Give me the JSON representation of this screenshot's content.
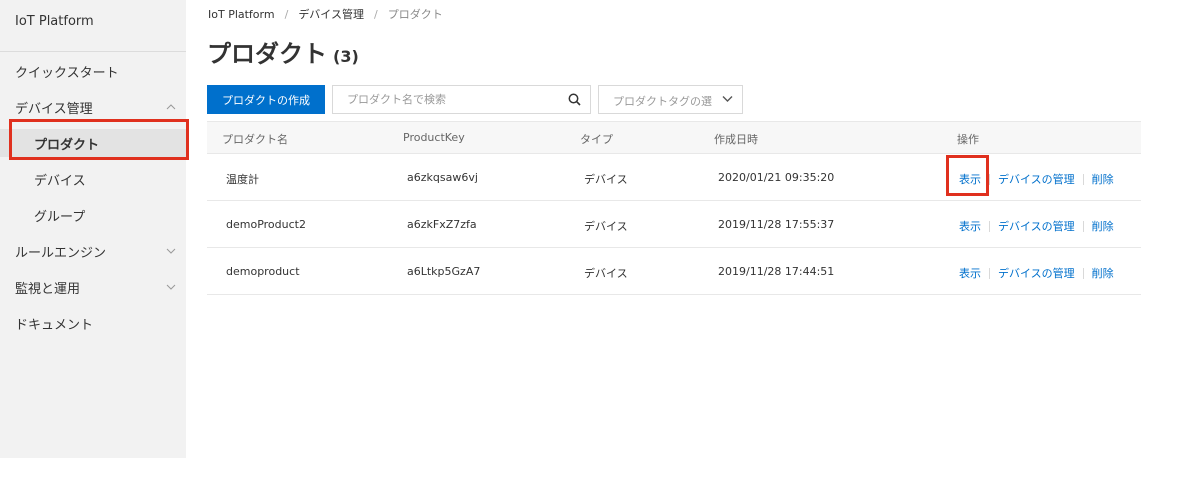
{
  "sidebar": {
    "brand": "IoT Platform",
    "items": [
      {
        "label": "クイックスタート"
      },
      {
        "label": "デバイス管理",
        "expanded": true
      },
      {
        "label": "プロダクト",
        "active": true
      },
      {
        "label": "デバイス"
      },
      {
        "label": "グループ"
      },
      {
        "label": "ルールエンジン",
        "expanded": false
      },
      {
        "label": "監視と運用",
        "expanded": false
      },
      {
        "label": "ドキュメント"
      }
    ]
  },
  "breadcrumb": [
    "IoT Platform",
    "デバイス管理",
    "プロダクト"
  ],
  "header": {
    "title": "プロダクト",
    "count": "(3)"
  },
  "toolbar": {
    "create_label": "プロダクトの作成",
    "search_placeholder": "プロダクト名で検索",
    "tag_placeholder": "プロダクトタグの選"
  },
  "table": {
    "columns": [
      "プロダクト名",
      "ProductKey",
      "タイプ",
      "作成日時",
      "操作"
    ],
    "rows": [
      {
        "name": "温度計",
        "key": "a6zkqsaw6vj",
        "type": "デバイス",
        "created": "2020/01/21 09:35:20"
      },
      {
        "name": "demoProduct2",
        "key": "a6zkFxZ7zfa",
        "type": "デバイス",
        "created": "2019/11/28 17:55:37"
      },
      {
        "name": "demoproduct",
        "key": "a6Ltkp5GzA7",
        "type": "デバイス",
        "created": "2019/11/28 17:44:51"
      }
    ],
    "actions": {
      "view": "表示",
      "manage": "デバイスの管理",
      "delete": "削除"
    }
  },
  "colors": {
    "primary": "#0070cc",
    "highlight": "#e0301e",
    "sidebar_bg": "#f2f2f2"
  },
  "icons": [
    "search-icon",
    "chevron-down-icon",
    "chevron-up-icon"
  ]
}
